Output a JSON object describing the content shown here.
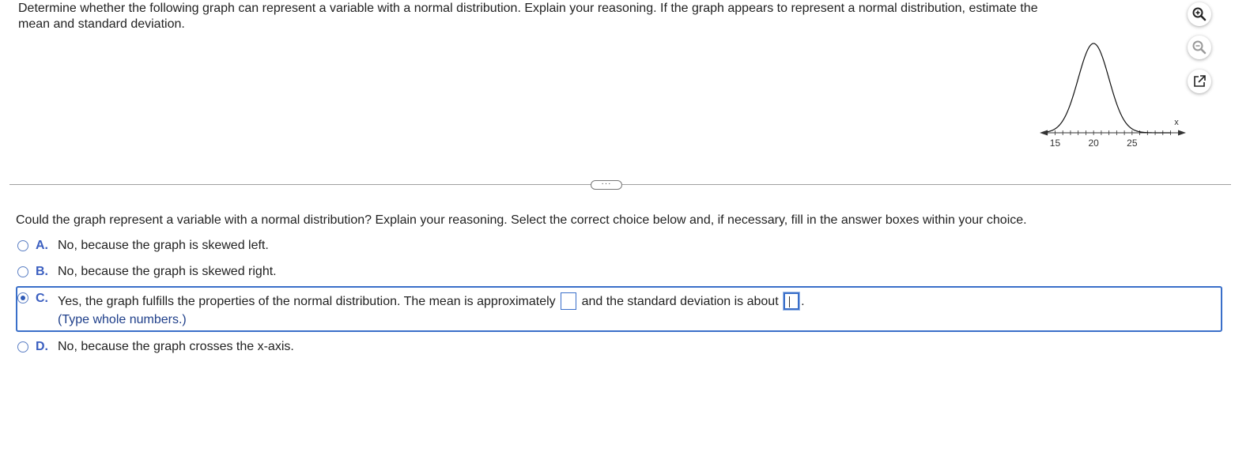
{
  "question": "Determine whether the following graph can represent a variable with a normal distribution. Explain your reasoning. If the graph appears to represent a normal distribution, estimate the mean and standard deviation.",
  "graph": {
    "axis_label": "x",
    "tick_labels": [
      "15",
      "20",
      "25"
    ],
    "curve": "normal",
    "center": 20,
    "spread": 2
  },
  "tools": {
    "zoom_in": "zoom-in-icon",
    "zoom_out": "zoom-out-icon",
    "popout": "external-link-icon"
  },
  "divider_handle": "···",
  "prompt": "Could the graph represent a variable with a normal distribution? Explain your reasoning. Select the correct choice below and, if necessary, fill in the answer boxes within your choice.",
  "choices": [
    {
      "letter": "A.",
      "text": "No, because the graph is skewed left.",
      "selected": false
    },
    {
      "letter": "B.",
      "text": "No, because the graph is skewed right.",
      "selected": false
    },
    {
      "letter": "C.",
      "text_before": "Yes, the graph fulfills the properties of the normal distribution. The mean is approximately",
      "text_middle": "and the standard deviation is about",
      "text_after": ".",
      "hint": "(Type whole numbers.)",
      "mean_value": "",
      "sd_value": "",
      "selected": true
    },
    {
      "letter": "D.",
      "text": "No, because the graph crosses the x-axis.",
      "selected": false
    }
  ],
  "colors": {
    "accent": "#3a6fc9",
    "letter": "#3b5fc0",
    "hint": "#1f3f8a"
  }
}
